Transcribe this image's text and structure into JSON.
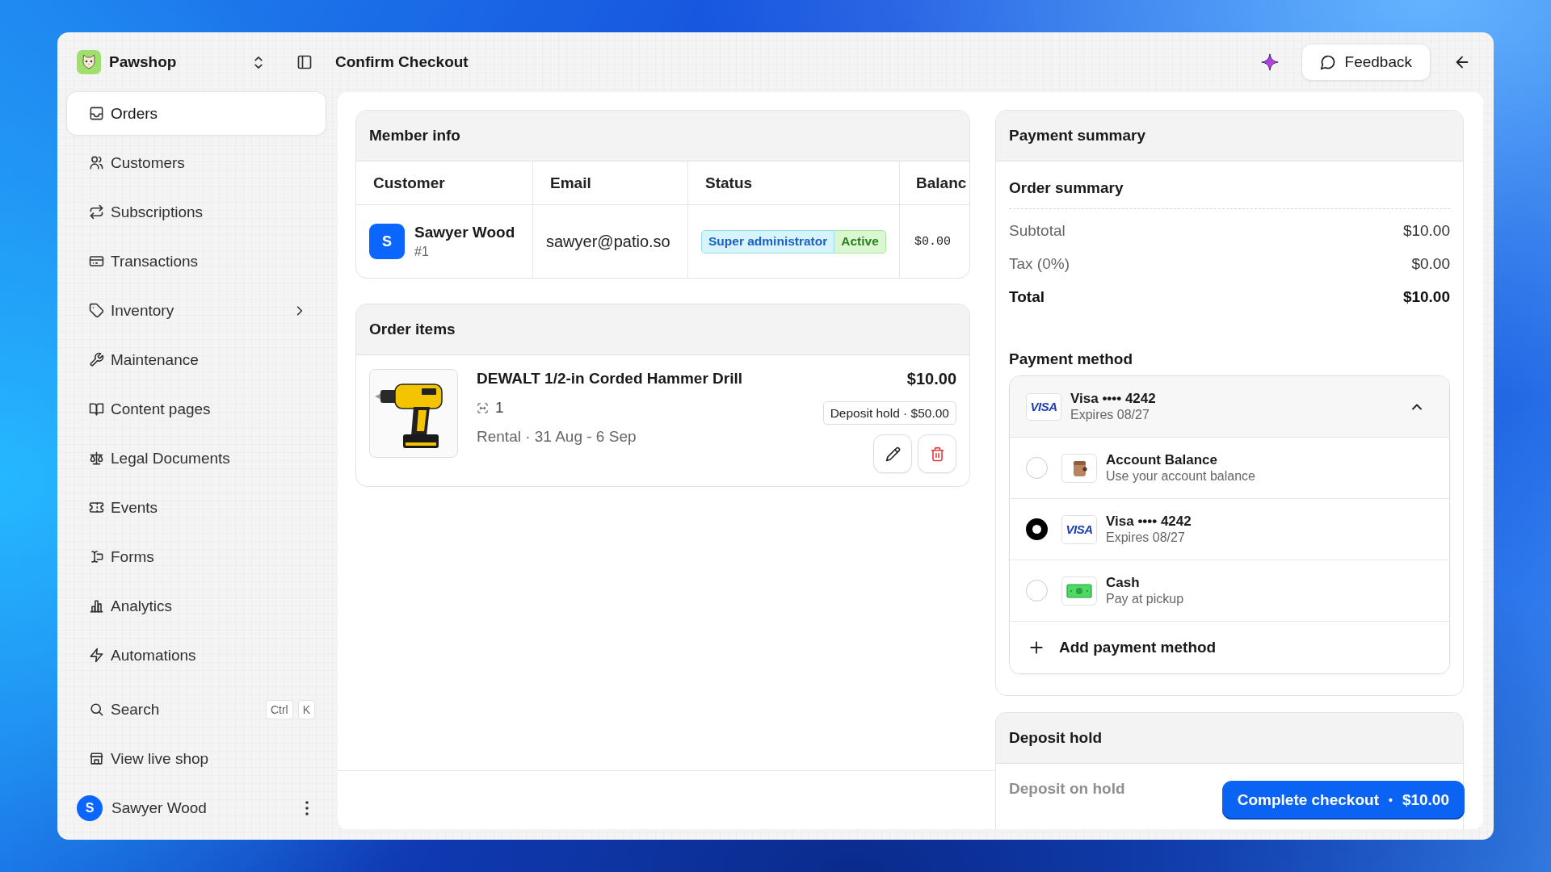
{
  "window": {
    "title": "Confirm Checkout"
  },
  "workspace": {
    "name": "Pawshop"
  },
  "topbar": {
    "feedback": "Feedback"
  },
  "sidebar": {
    "items": [
      {
        "label": "Orders",
        "kind": "link",
        "selected": true
      },
      {
        "label": "Customers",
        "kind": "link",
        "selected": false
      },
      {
        "label": "Subscriptions",
        "kind": "link",
        "selected": false
      },
      {
        "label": "Transactions",
        "kind": "link",
        "selected": false
      },
      {
        "label": "Inventory",
        "kind": "group",
        "selected": false
      },
      {
        "label": "Maintenance",
        "kind": "link",
        "selected": false
      },
      {
        "label": "Content pages",
        "kind": "link",
        "selected": false
      },
      {
        "label": "Legal Documents",
        "kind": "link",
        "selected": false
      },
      {
        "label": "Events",
        "kind": "link",
        "selected": false
      },
      {
        "label": "Forms",
        "kind": "link",
        "selected": false
      },
      {
        "label": "Analytics",
        "kind": "link",
        "selected": false
      },
      {
        "label": "Automations",
        "kind": "link",
        "selected": false
      }
    ],
    "search": {
      "label": "Search",
      "keys": [
        "Ctrl",
        "K"
      ]
    },
    "shop_link": "View live shop",
    "user": {
      "initial": "S",
      "name": "Sawyer Wood"
    }
  },
  "member_info": {
    "title": "Member info",
    "columns": [
      "Customer",
      "Email",
      "Status",
      "Balanc"
    ],
    "rows": [
      {
        "initial": "S",
        "name": "Sawyer Wood",
        "number": "#1",
        "email": "sawyer@patio.so",
        "badges": [
          {
            "label": "Super administrator",
            "kind": "role"
          },
          {
            "label": "Active",
            "kind": "status"
          }
        ],
        "balance": "$0.00"
      }
    ]
  },
  "order_items": {
    "title": "Order items",
    "items": [
      {
        "name": "DEWALT 1/2-in Corded Hammer Drill",
        "quantity": "1",
        "details": "Rental · 31 Aug - 6 Sep",
        "price": "$10.00",
        "deposit": "Deposit hold · $50.00"
      }
    ]
  },
  "payment_summary": {
    "title": "Payment summary",
    "order_summary": {
      "title": "Order summary",
      "lines": [
        {
          "label": "Subtotal",
          "value": "$10.00",
          "kind": "line"
        },
        {
          "label": "Tax (0%)",
          "value": "$0.00",
          "kind": "line"
        },
        {
          "label": "Total",
          "value": "$10.00",
          "kind": "total"
        }
      ]
    },
    "payment_method": {
      "title": "Payment method",
      "current": {
        "kind": "visa",
        "logo": "VISA",
        "title": "Visa •••• 4242",
        "subtitle": "Expires 08/27",
        "expanded": true
      },
      "options": [
        {
          "kind": "balance",
          "title": "Account Balance",
          "subtitle": "Use your account balance",
          "selected": false
        },
        {
          "kind": "visa",
          "logo": "VISA",
          "title": "Visa •••• 4242",
          "subtitle": "Expires 08/27",
          "selected": true
        },
        {
          "kind": "cash",
          "title": "Cash",
          "subtitle": "Pay at pickup",
          "selected": false
        }
      ],
      "add_label": "Add payment method"
    }
  },
  "deposit_hold": {
    "title": "Deposit hold",
    "line": "Deposit on hold"
  },
  "footer": {
    "checkout_button": {
      "label": "Complete checkout",
      "separator": "•",
      "amount": "$10.00"
    }
  }
}
